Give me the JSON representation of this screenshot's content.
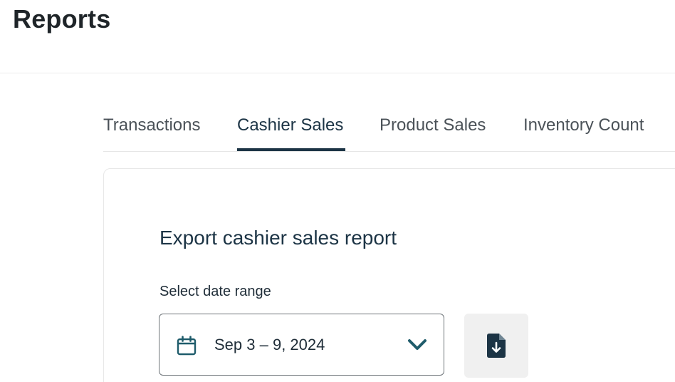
{
  "page": {
    "title": "Reports"
  },
  "tabs": [
    {
      "label": "Transactions",
      "active": false
    },
    {
      "label": "Cashier Sales",
      "active": true
    },
    {
      "label": "Product Sales",
      "active": false
    },
    {
      "label": "Inventory Count",
      "active": false
    }
  ],
  "export": {
    "title": "Export cashier sales report",
    "date_range_label": "Select date range",
    "date_range_value": "Sep 3 – 9, 2024",
    "calendar_icon": "calendar-icon",
    "dropdown_icon": "chevron-down-icon",
    "download_icon": "file-download-icon"
  },
  "colors": {
    "accent": "#1c3445",
    "icon_teal": "#1f5c6b",
    "button_bg": "#f0f0f0"
  }
}
